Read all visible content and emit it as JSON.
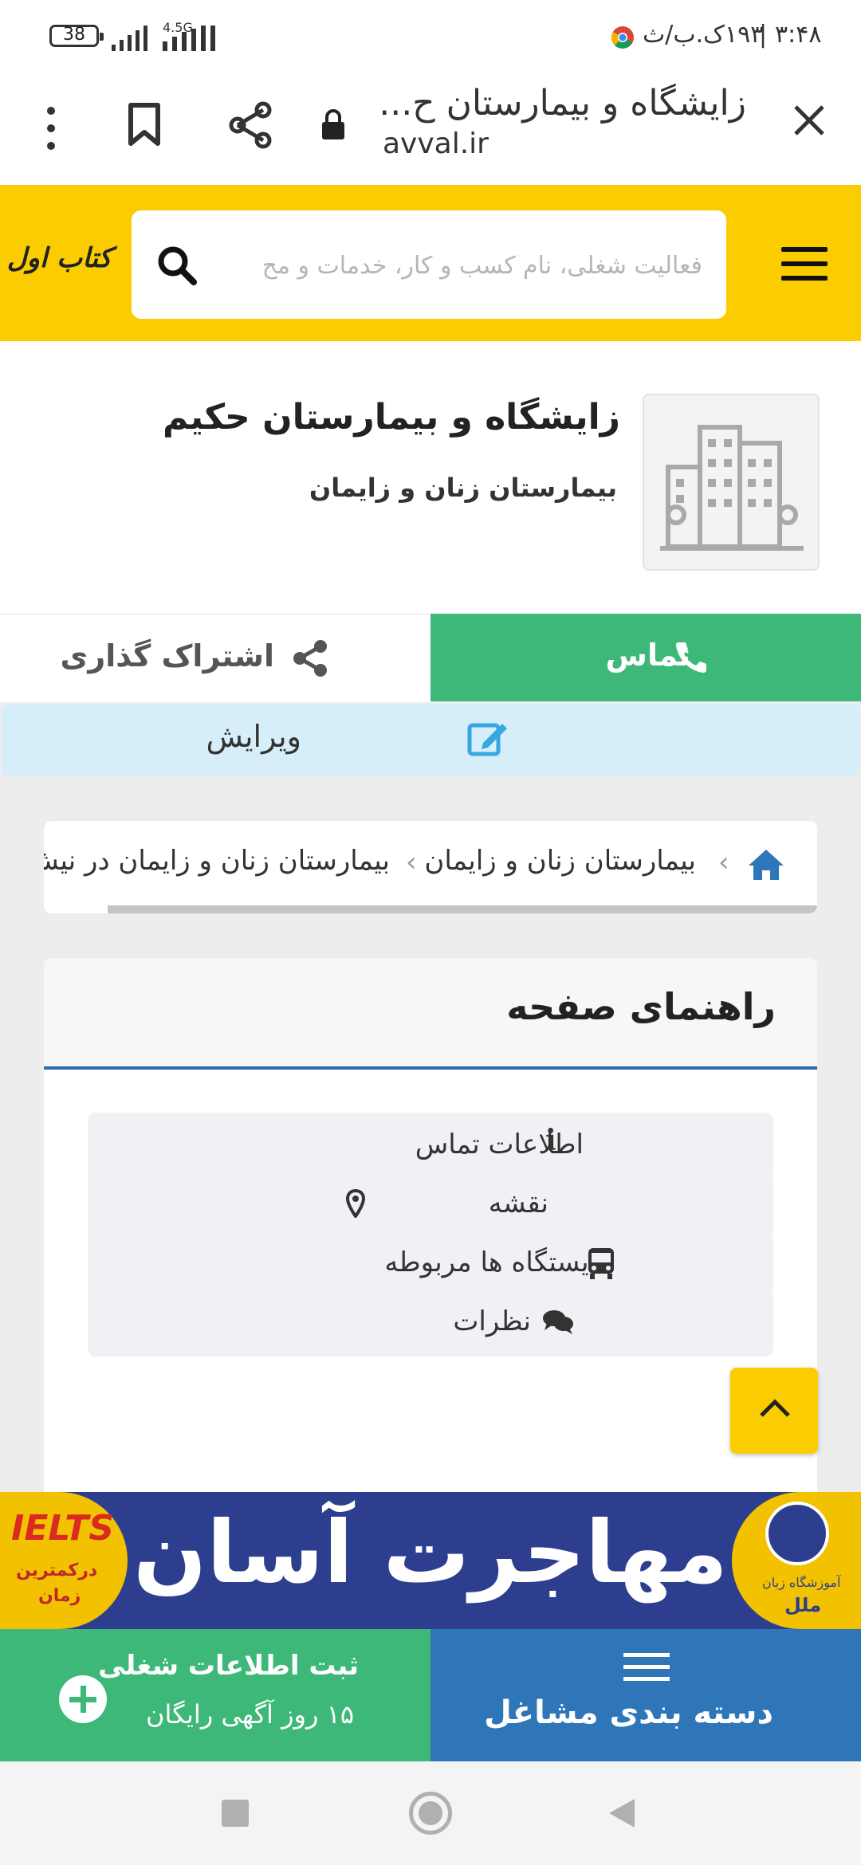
{
  "status_bar": {
    "time": "۳:۴۸",
    "kb": "۱۹۳ک.ب/ث",
    "separator": "|",
    "battery": "38",
    "network": "4.5G"
  },
  "browser": {
    "page_title": "زایشگاه و بیمارستان ح...",
    "url": "avval.ir"
  },
  "header": {
    "logo_text": "کتاب اول",
    "search_placeholder": "فعالیت شغلی، نام کسب و کار، خدمات و مح"
  },
  "profile": {
    "title": "زایشگاه و بیمارستان حکیم",
    "subtitle": "بیمارستان زنان و زایمان"
  },
  "actions": {
    "call_label": "تماس",
    "share_label": "اشتراک گذاری",
    "edit_label": "ویرایش"
  },
  "breadcrumb": {
    "items": [
      "بیمارستان زنان و زایمان",
      "بیمارستان زنان و زایمان در نیش"
    ]
  },
  "guide": {
    "title": "راهنمای صفحه",
    "items": [
      {
        "label": "اطلاعات تماس",
        "icon": "info-icon"
      },
      {
        "label": "نقشه",
        "icon": "map-pin-icon"
      },
      {
        "label": "ایستگاه ها مربوطه",
        "icon": "bus-icon"
      },
      {
        "label": "نظرات",
        "icon": "comments-icon"
      }
    ]
  },
  "banner": {
    "title": "مهاجرت آسان",
    "left_badge": "IELTS",
    "left_sub_1": "درکمترین",
    "left_sub_2": "زمان",
    "right_sub_1": "آموزشگاه زبان",
    "right_sub_2": "ملل"
  },
  "bottom": {
    "register_title": "ثبت اطلاعات شغلی",
    "register_sub": "۱۵ روز آگهی رایگان",
    "categories_label": "دسته بندی مشاغل"
  },
  "colors": {
    "brand_yellow": "#fbcd00",
    "green": "#3db878",
    "blue": "#2f76b9",
    "banner_navy": "#2e3e8f"
  }
}
